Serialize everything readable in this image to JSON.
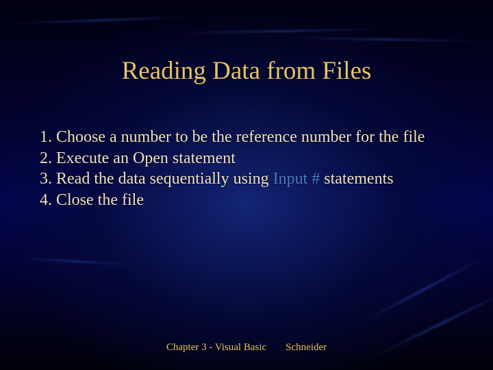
{
  "title": "Reading Data from Files",
  "items": {
    "i1": "1. Choose a number to be the reference number for the file",
    "i2": "2. Execute an Open statement",
    "i3_prefix": "3. Read the data sequentially using ",
    "i3_hl": "Input #",
    "i3_suffix": " statements",
    "i4": "4. Close the file"
  },
  "footer": {
    "left": "Chapter 3 - Visual Basic",
    "right": "Schneider"
  }
}
